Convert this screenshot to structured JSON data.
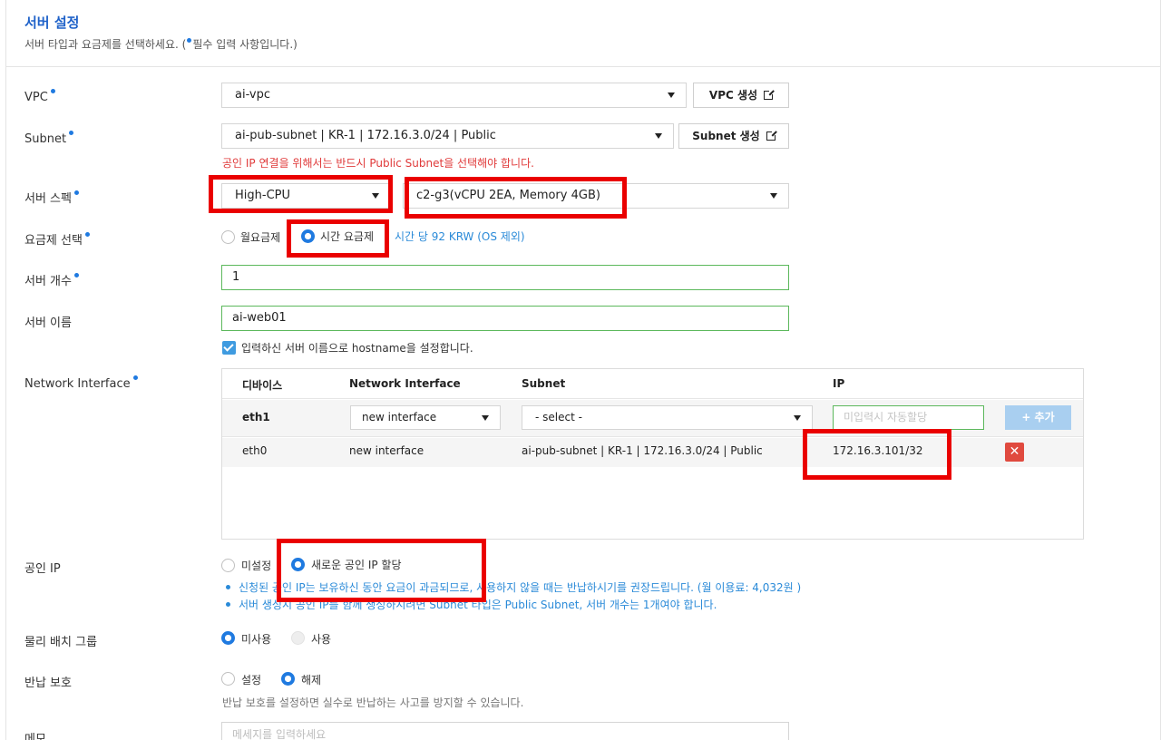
{
  "header": {
    "title": "서버 설정",
    "subtitle_before": "서버 타입과 요금제를 선택하세요. (",
    "subtitle_after": "필수 입력 사항입니다.)"
  },
  "vpc": {
    "label": "VPC",
    "value": "ai-vpc",
    "create_button": "VPC 생성"
  },
  "subnet": {
    "label": "Subnet",
    "value": "ai-pub-subnet | KR-1 | 172.16.3.0/24 | Public",
    "create_button": "Subnet 생성",
    "warning": "공인 IP 연결을 위해서는 반드시 Public Subnet을 선택해야 합니다."
  },
  "server_spec": {
    "label": "서버 스펙",
    "type_value": "High-CPU",
    "spec_value": "c2-g3(vCPU 2EA, Memory 4GB)"
  },
  "billing": {
    "label": "요금제 선택",
    "options": [
      "월요금제",
      "시간 요금제"
    ],
    "selected": "시간 요금제",
    "price_note": "시간 당 92 KRW (OS 제외)"
  },
  "server_count": {
    "label": "서버 개수",
    "value": "1"
  },
  "server_name": {
    "label": "서버 이름",
    "value": "ai-web01",
    "hostname_checkbox_label": "입력하신 서버 이름으로 hostname을 설정합니다.",
    "hostname_checked": true
  },
  "network_interface": {
    "label": "Network Interface",
    "columns": [
      "디바이스",
      "Network Interface",
      "Subnet",
      "IP"
    ],
    "new_row": {
      "device": "eth1",
      "interface_value": "new interface",
      "subnet_value": "- select -",
      "ip_placeholder": "미입력시 자동할당",
      "add_button": "+ 추가"
    },
    "rows": [
      {
        "device": "eth0",
        "interface": "new interface",
        "subnet": "ai-pub-subnet | KR-1 | 172.16.3.0/24 | Public",
        "ip": "172.16.3.101/32",
        "delete_symbol": "✕"
      }
    ]
  },
  "public_ip": {
    "label": "공인 IP",
    "options": [
      "미설정",
      "새로운 공인 IP 할당"
    ],
    "selected": "새로운 공인 IP 할당",
    "notes": [
      "신청된 공인 IP는 보유하신 동안 요금이 과금되므로, 사용하지 않을 때는 반납하시기를 권장드립니다. (월 이용료: 4,032원 )",
      "서버 생성시 공인 IP를 함께 생성하시려면 Subnet 타입은 Public Subnet, 서버 개수는 1개여야 합니다."
    ]
  },
  "placement_group": {
    "label": "물리 배치 그룹",
    "options": [
      "미사용",
      "사용"
    ],
    "selected": "미사용"
  },
  "termination_protection": {
    "label": "반납 보호",
    "options": [
      "설정",
      "해제"
    ],
    "selected": "해제",
    "hint": "반납 보호를 설정하면 실수로 반납하는 사고를 방지할 수 있습니다."
  },
  "memo": {
    "label": "메모",
    "placeholder": "메세지를 입력하세요"
  },
  "colors": {
    "accent": "#1f7ae0",
    "title_blue": "#1f62c9",
    "warning_red": "#e03a3a",
    "annotation_red": "#ea0000",
    "valid_green": "#5cb85c",
    "note_blue": "#2a8ad8"
  }
}
